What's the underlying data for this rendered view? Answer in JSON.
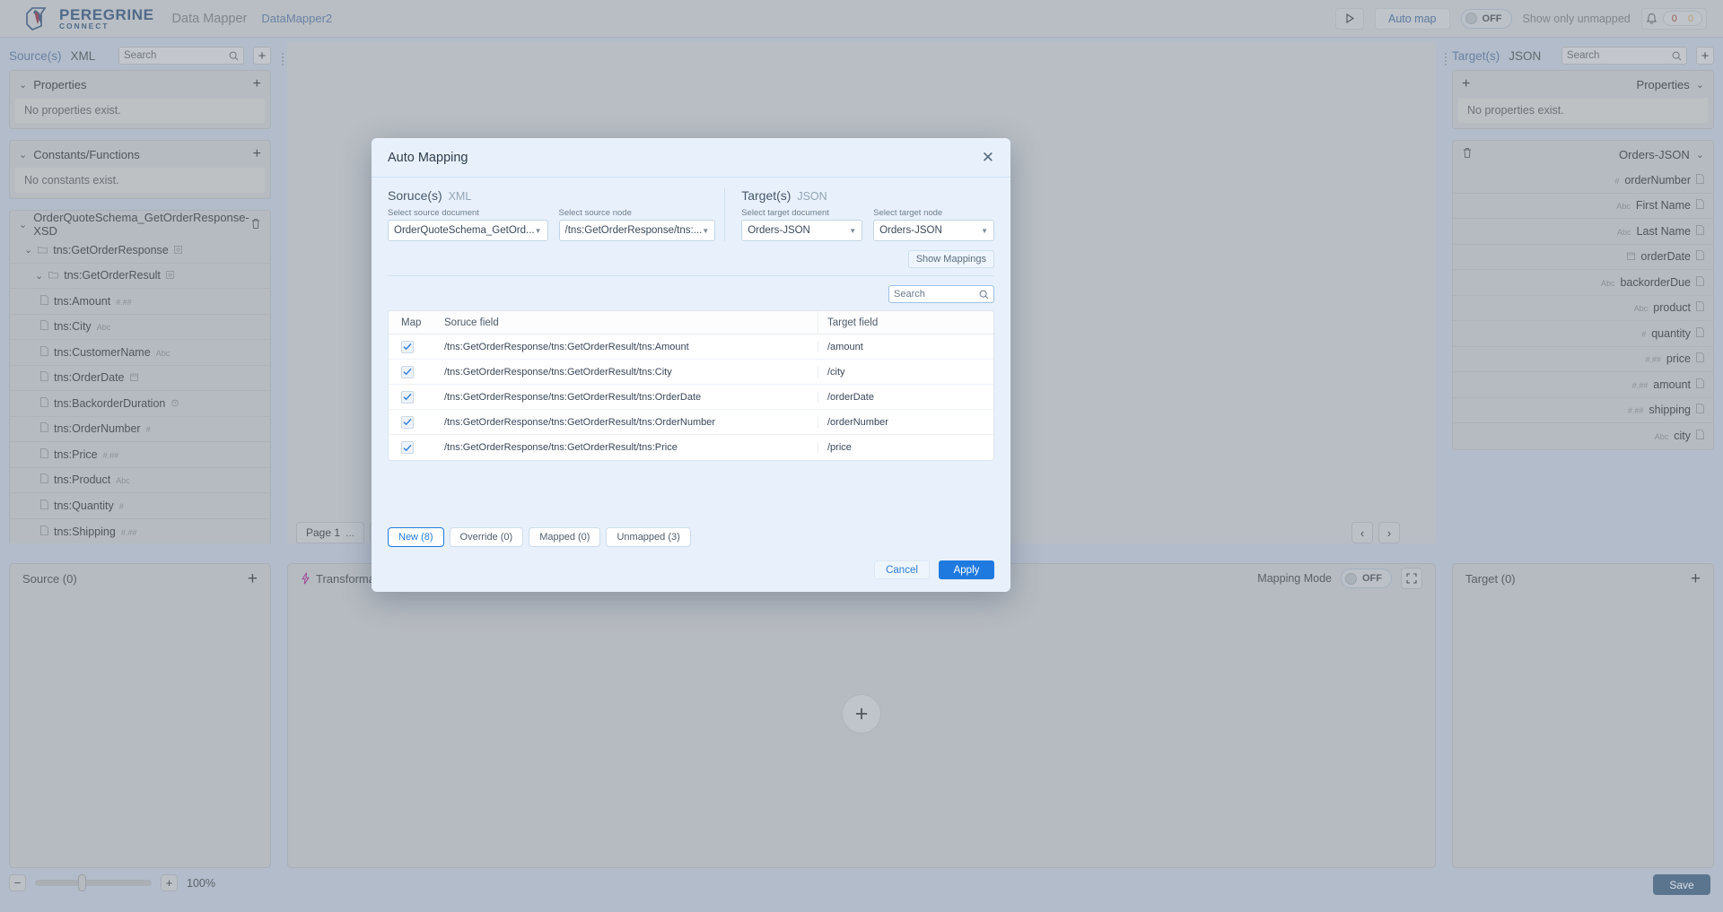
{
  "header": {
    "brand_line1": "PEREGRINE",
    "brand_line2": "CONNECT",
    "app_name": "Data Mapper",
    "document_name": "DataMapper2",
    "run_icon": "play-icon",
    "auto_map_label": "Auto map",
    "unmapped_toggle_state": "OFF",
    "unmapped_toggle_label": "Show only unmapped",
    "bell_icon": "bell-icon",
    "badge_error_count": "0",
    "badge_warning_count": "0",
    "badge_error_color": "#d03a3a",
    "badge_warning_color": "#e2941f"
  },
  "source_panel": {
    "title": "Source(s)",
    "format": "XML",
    "search_placeholder": "Search",
    "add_icon": "plus-icon",
    "properties": {
      "title": "Properties",
      "empty_text": "No properties exist."
    },
    "constants": {
      "title": "Constants/Functions",
      "empty_text": "No constants exist."
    },
    "schema": {
      "title": "OrderQuoteSchema_GetOrderResponse-XSD",
      "delete_icon": "trash-icon",
      "nodes": [
        {
          "label": "tns:GetOrderResponse",
          "type": "",
          "kind": "folder",
          "indent": 1
        },
        {
          "label": "tns:GetOrderResult",
          "type": "",
          "kind": "folder",
          "indent": 2
        },
        {
          "label": "tns:Amount",
          "type": "#.##",
          "kind": "file",
          "indent": 3
        },
        {
          "label": "tns:City",
          "type": "Abc",
          "kind": "file",
          "indent": 3
        },
        {
          "label": "tns:CustomerName",
          "type": "Abc",
          "kind": "file",
          "indent": 3
        },
        {
          "label": "tns:OrderDate",
          "type": "date",
          "kind": "file",
          "indent": 3
        },
        {
          "label": "tns:BackorderDuration",
          "type": "time",
          "kind": "file",
          "indent": 3
        },
        {
          "label": "tns:OrderNumber",
          "type": "#",
          "kind": "file",
          "indent": 3
        },
        {
          "label": "tns:Price",
          "type": "#.##",
          "kind": "file",
          "indent": 3
        },
        {
          "label": "tns:Product",
          "type": "Abc",
          "kind": "file",
          "indent": 3
        },
        {
          "label": "tns:Quantity",
          "type": "#",
          "kind": "file",
          "indent": 3
        },
        {
          "label": "tns:Shipping",
          "type": "#.##",
          "kind": "file",
          "indent": 3
        }
      ]
    }
  },
  "target_panel": {
    "title": "Target(s)",
    "format": "JSON",
    "search_placeholder": "Search",
    "add_icon": "plus-icon",
    "properties": {
      "title": "Properties",
      "empty_text": "No properties exist.",
      "add_icon": "plus-icon"
    },
    "schema": {
      "title": "Orders-JSON",
      "delete_icon": "trash-icon",
      "nodes": [
        {
          "label": "orderNumber",
          "type": "#"
        },
        {
          "label": "First Name",
          "type": "Abc"
        },
        {
          "label": "Last Name",
          "type": "Abc"
        },
        {
          "label": "orderDate",
          "type": "date"
        },
        {
          "label": "backorderDue",
          "type": "Abc"
        },
        {
          "label": "product",
          "type": "Abc"
        },
        {
          "label": "quantity",
          "type": "#"
        },
        {
          "label": "price",
          "type": "#.##"
        },
        {
          "label": "amount",
          "type": "#.##"
        },
        {
          "label": "shipping",
          "type": "#.##"
        },
        {
          "label": "city",
          "type": "Abc"
        }
      ]
    }
  },
  "canvas": {
    "page_tab_label": "Page 1",
    "page_tab_more": "...",
    "add_page_label": "+",
    "prev_page_icon": "chevron-left-icon",
    "next_page_icon": "chevron-right-icon"
  },
  "bottom": {
    "source_box_label": "Source (0)",
    "transformation_label": "Transformation",
    "transformation_icon": "lightning-icon",
    "transformation_add_icon": "plus-circle-icon",
    "mode_label": "Mapping Mode",
    "mode_state": "OFF",
    "fullscreen_icon": "fullscreen-icon",
    "target_box_label": "Target (0)",
    "zoom_out_icon": "minus-icon",
    "zoom_in_icon": "plus-icon",
    "zoom_level": "100%",
    "save_label": "Save"
  },
  "modal": {
    "title": "Auto Mapping",
    "close_icon": "close-icon",
    "source_section": {
      "title": "Soruce(s)",
      "format": "XML",
      "document_label": "Select source document",
      "document_value": "OrderQuoteSchema_GetOrd...",
      "node_label": "Select source node",
      "node_value": "/tns:GetOrderResponse/tns:..."
    },
    "target_section": {
      "title": "Target(s)",
      "format": "JSON",
      "document_label": "Select target document",
      "document_value": "Orders-JSON",
      "node_label": "Select target node",
      "node_value": "Orders-JSON"
    },
    "show_mappings_label": "Show Mappings",
    "table_search_placeholder": "Search",
    "table": {
      "columns": [
        "Map",
        "Soruce field",
        "Target field"
      ],
      "rows": [
        {
          "checked": true,
          "source": "/tns:GetOrderResponse/tns:GetOrderResult/tns:Amount",
          "target": "/amount"
        },
        {
          "checked": true,
          "source": "/tns:GetOrderResponse/tns:GetOrderResult/tns:City",
          "target": "/city"
        },
        {
          "checked": true,
          "source": "/tns:GetOrderResponse/tns:GetOrderResult/tns:OrderDate",
          "target": "/orderDate"
        },
        {
          "checked": true,
          "source": "/tns:GetOrderResponse/tns:GetOrderResult/tns:OrderNumber",
          "target": "/orderNumber"
        },
        {
          "checked": true,
          "source": "/tns:GetOrderResponse/tns:GetOrderResult/tns:Price",
          "target": "/price"
        }
      ]
    },
    "filters": [
      {
        "label": "New (8)",
        "active": true
      },
      {
        "label": "Override (0)",
        "active": false
      },
      {
        "label": "Mapped (0)",
        "active": false
      },
      {
        "label": "Unmapped (3)",
        "active": false
      }
    ],
    "cancel_label": "Cancel",
    "apply_label": "Apply"
  }
}
